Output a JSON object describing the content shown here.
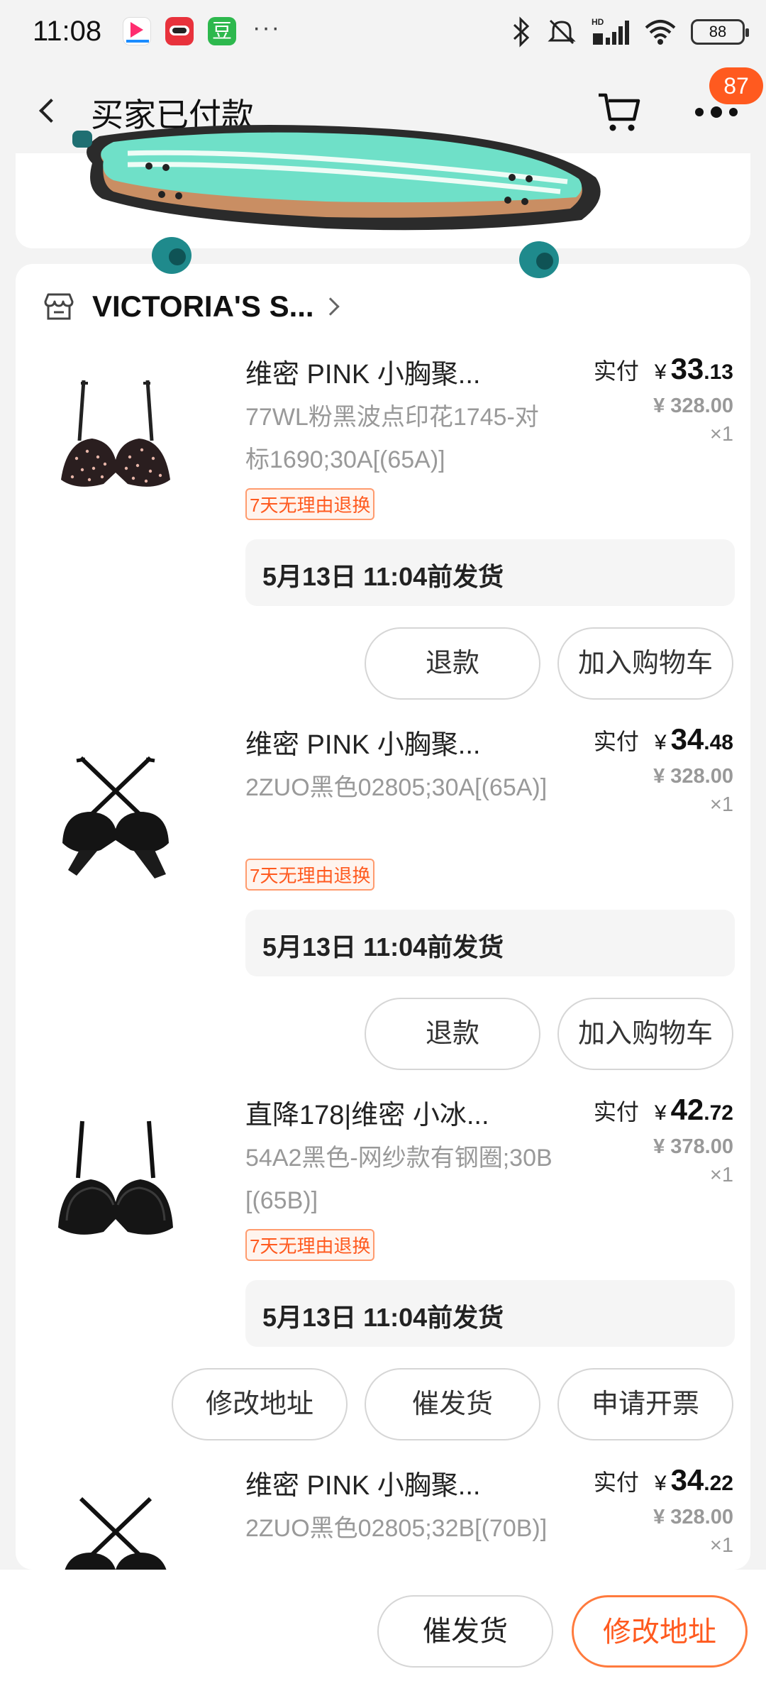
{
  "status_bar": {
    "time": "11:08",
    "more": "···",
    "battery": "88",
    "icons": [
      "youku-icon",
      "app-icon",
      "douban-icon",
      "bluetooth-icon",
      "mute-icon",
      "signal-icon",
      "wifi-icon",
      "battery-icon"
    ],
    "douban_char": "豆"
  },
  "header": {
    "title": "买家已付款",
    "badge_count": "87"
  },
  "store": {
    "name": "VICTORIA'S S..."
  },
  "items": [
    {
      "title": "维密 PINK 小胸聚...",
      "sku": "77WL粉黑波点印花1745-对标1690;30A[(65A)]",
      "tag": "7天无理由退换",
      "price_label": "实付",
      "yen": "¥",
      "price_int": "33",
      "price_dec": ".13",
      "orig_price": "¥ 328.00",
      "qty": "×1",
      "ship": "5月13日 11:04前发货",
      "buttons": [
        "退款",
        "加入购物车"
      ]
    },
    {
      "title": "维密 PINK 小胸聚...",
      "sku": "2ZUO黑色02805;30A[(65A)]",
      "tag": "7天无理由退换",
      "price_label": "实付",
      "yen": "¥",
      "price_int": "34",
      "price_dec": ".48",
      "orig_price": "¥ 328.00",
      "qty": "×1",
      "ship": "5月13日 11:04前发货",
      "buttons": [
        "退款",
        "加入购物车"
      ]
    },
    {
      "title": "直降178|维密 小冰...",
      "sku": "54A2黑色-网纱款有钢圈;30B[(65B)]",
      "tag": "7天无理由退换",
      "price_label": "实付",
      "yen": "¥",
      "price_int": "42",
      "price_dec": ".72",
      "orig_price": "¥ 378.00",
      "qty": "×1",
      "ship": "5月13日 11:04前发货",
      "buttons": [
        "修改地址",
        "催发货",
        "申请开票"
      ]
    },
    {
      "title": "维密 PINK 小胸聚...",
      "sku": "2ZUO黑色02805;32B[(70B)]",
      "price_label": "实付",
      "yen": "¥",
      "price_int": "34",
      "price_dec": ".22",
      "orig_price": "¥ 328.00",
      "qty": "×1"
    }
  ],
  "bottom_bar": {
    "urge_ship": "催发货",
    "modify_address": "修改地址"
  },
  "colors": {
    "accent": "#ff5a1f",
    "badge": "#ff5a1f",
    "skateboard_deck": "#6fe0c8",
    "skateboard_wheels": "#1f8a8c"
  }
}
